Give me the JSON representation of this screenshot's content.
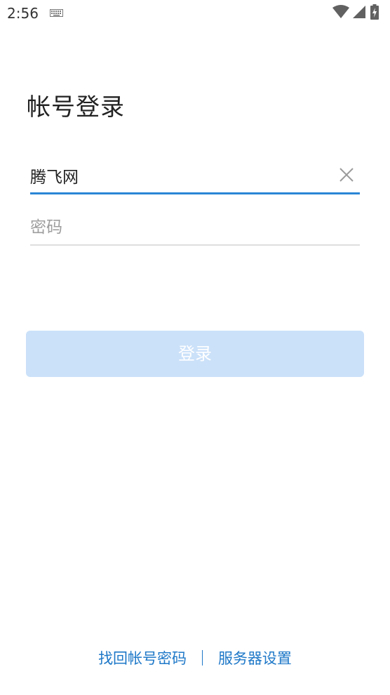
{
  "status_bar": {
    "time": "2:56",
    "icons": [
      "keyboard-icon",
      "wifi-icon",
      "signal-icon",
      "battery-charging-icon"
    ]
  },
  "page": {
    "title": "帐号登录"
  },
  "account_field": {
    "value": "腾飞网",
    "accent_color": "#2b86d6"
  },
  "password_field": {
    "value": "",
    "placeholder": "密码"
  },
  "login_button": {
    "label": "登录",
    "background_color": "#cbe1f9",
    "state": "disabled"
  },
  "footer": {
    "recover_label": "找回帐号密码",
    "server_settings_label": "服务器设置",
    "link_color": "#1e78c8"
  }
}
